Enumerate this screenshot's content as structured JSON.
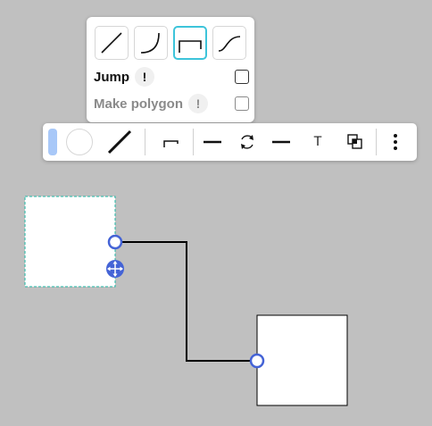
{
  "connector_popover": {
    "styles": [
      {
        "name": "straight",
        "selected": false
      },
      {
        "name": "curved",
        "selected": false
      },
      {
        "name": "elbow",
        "selected": true
      },
      {
        "name": "s-curve",
        "selected": false
      }
    ],
    "options": [
      {
        "label": "Jump",
        "help": "!",
        "checked": false,
        "enabled": true
      },
      {
        "label": "Make polygon",
        "help": "!",
        "checked": false,
        "enabled": false
      }
    ]
  },
  "toolbar": {
    "fill_color": "#a8c8f8",
    "line_color": "#111111",
    "text_tool_label": "T",
    "items": [
      "fill-color",
      "stroke-color",
      "line-style",
      "connector-style",
      "line-start",
      "rotate",
      "line-end",
      "text",
      "arrange",
      "more"
    ]
  },
  "canvas": {
    "accent": "#4463d6",
    "selection_color": "#1fb7a6",
    "connector_color": "#000000"
  }
}
